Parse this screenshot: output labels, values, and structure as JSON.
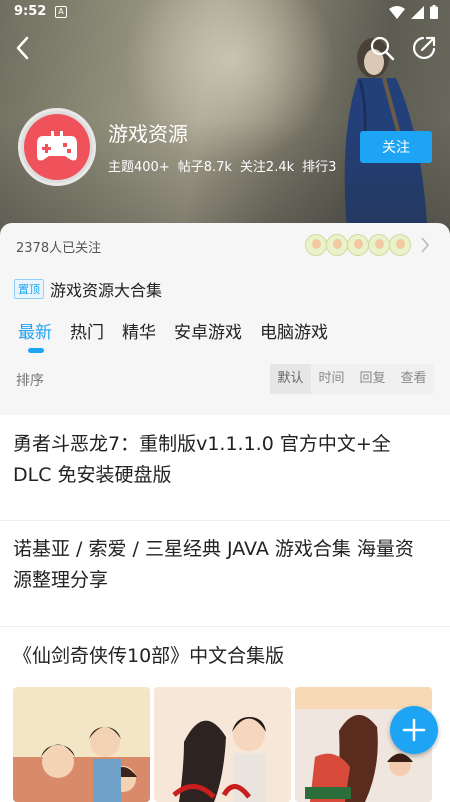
{
  "status_bar": {
    "time": "9:52",
    "notification_badge": "A"
  },
  "header": {
    "back_icon": "back-arrow-icon",
    "search_icon": "search-icon",
    "share_icon": "share-icon"
  },
  "forum": {
    "title": "游戏资源",
    "stats": [
      "主题400+",
      "帖子8.7k",
      "关注2.4k",
      "排行3"
    ],
    "follow_label": "关注",
    "avatar_icon": "gamepad-icon",
    "avatar_color": "#f0525c"
  },
  "followers": {
    "count_text": "2378人已关注"
  },
  "pinned": {
    "badge": "置顶",
    "title": "游戏资源大合集"
  },
  "tabs": [
    "最新",
    "热门",
    "精华",
    "安卓游戏",
    "电脑游戏"
  ],
  "active_tab": "最新",
  "sort": {
    "label": "排序",
    "options": [
      "默认",
      "时间",
      "回复",
      "查看"
    ],
    "active": "默认"
  },
  "posts": [
    {
      "title": "勇者斗恶龙7：重制版v1.1.1.0 官方中文+全DLC 免安装硬盘版"
    },
    {
      "title": "诺基亚 / 索爱 / 三星经典 JAVA 游戏合集 海量资源整理分享"
    },
    {
      "title": "《仙剑奇侠传10部》中文合集版"
    }
  ],
  "fab": {
    "icon": "plus-icon"
  },
  "colors": {
    "accent": "#1ea4f5"
  }
}
